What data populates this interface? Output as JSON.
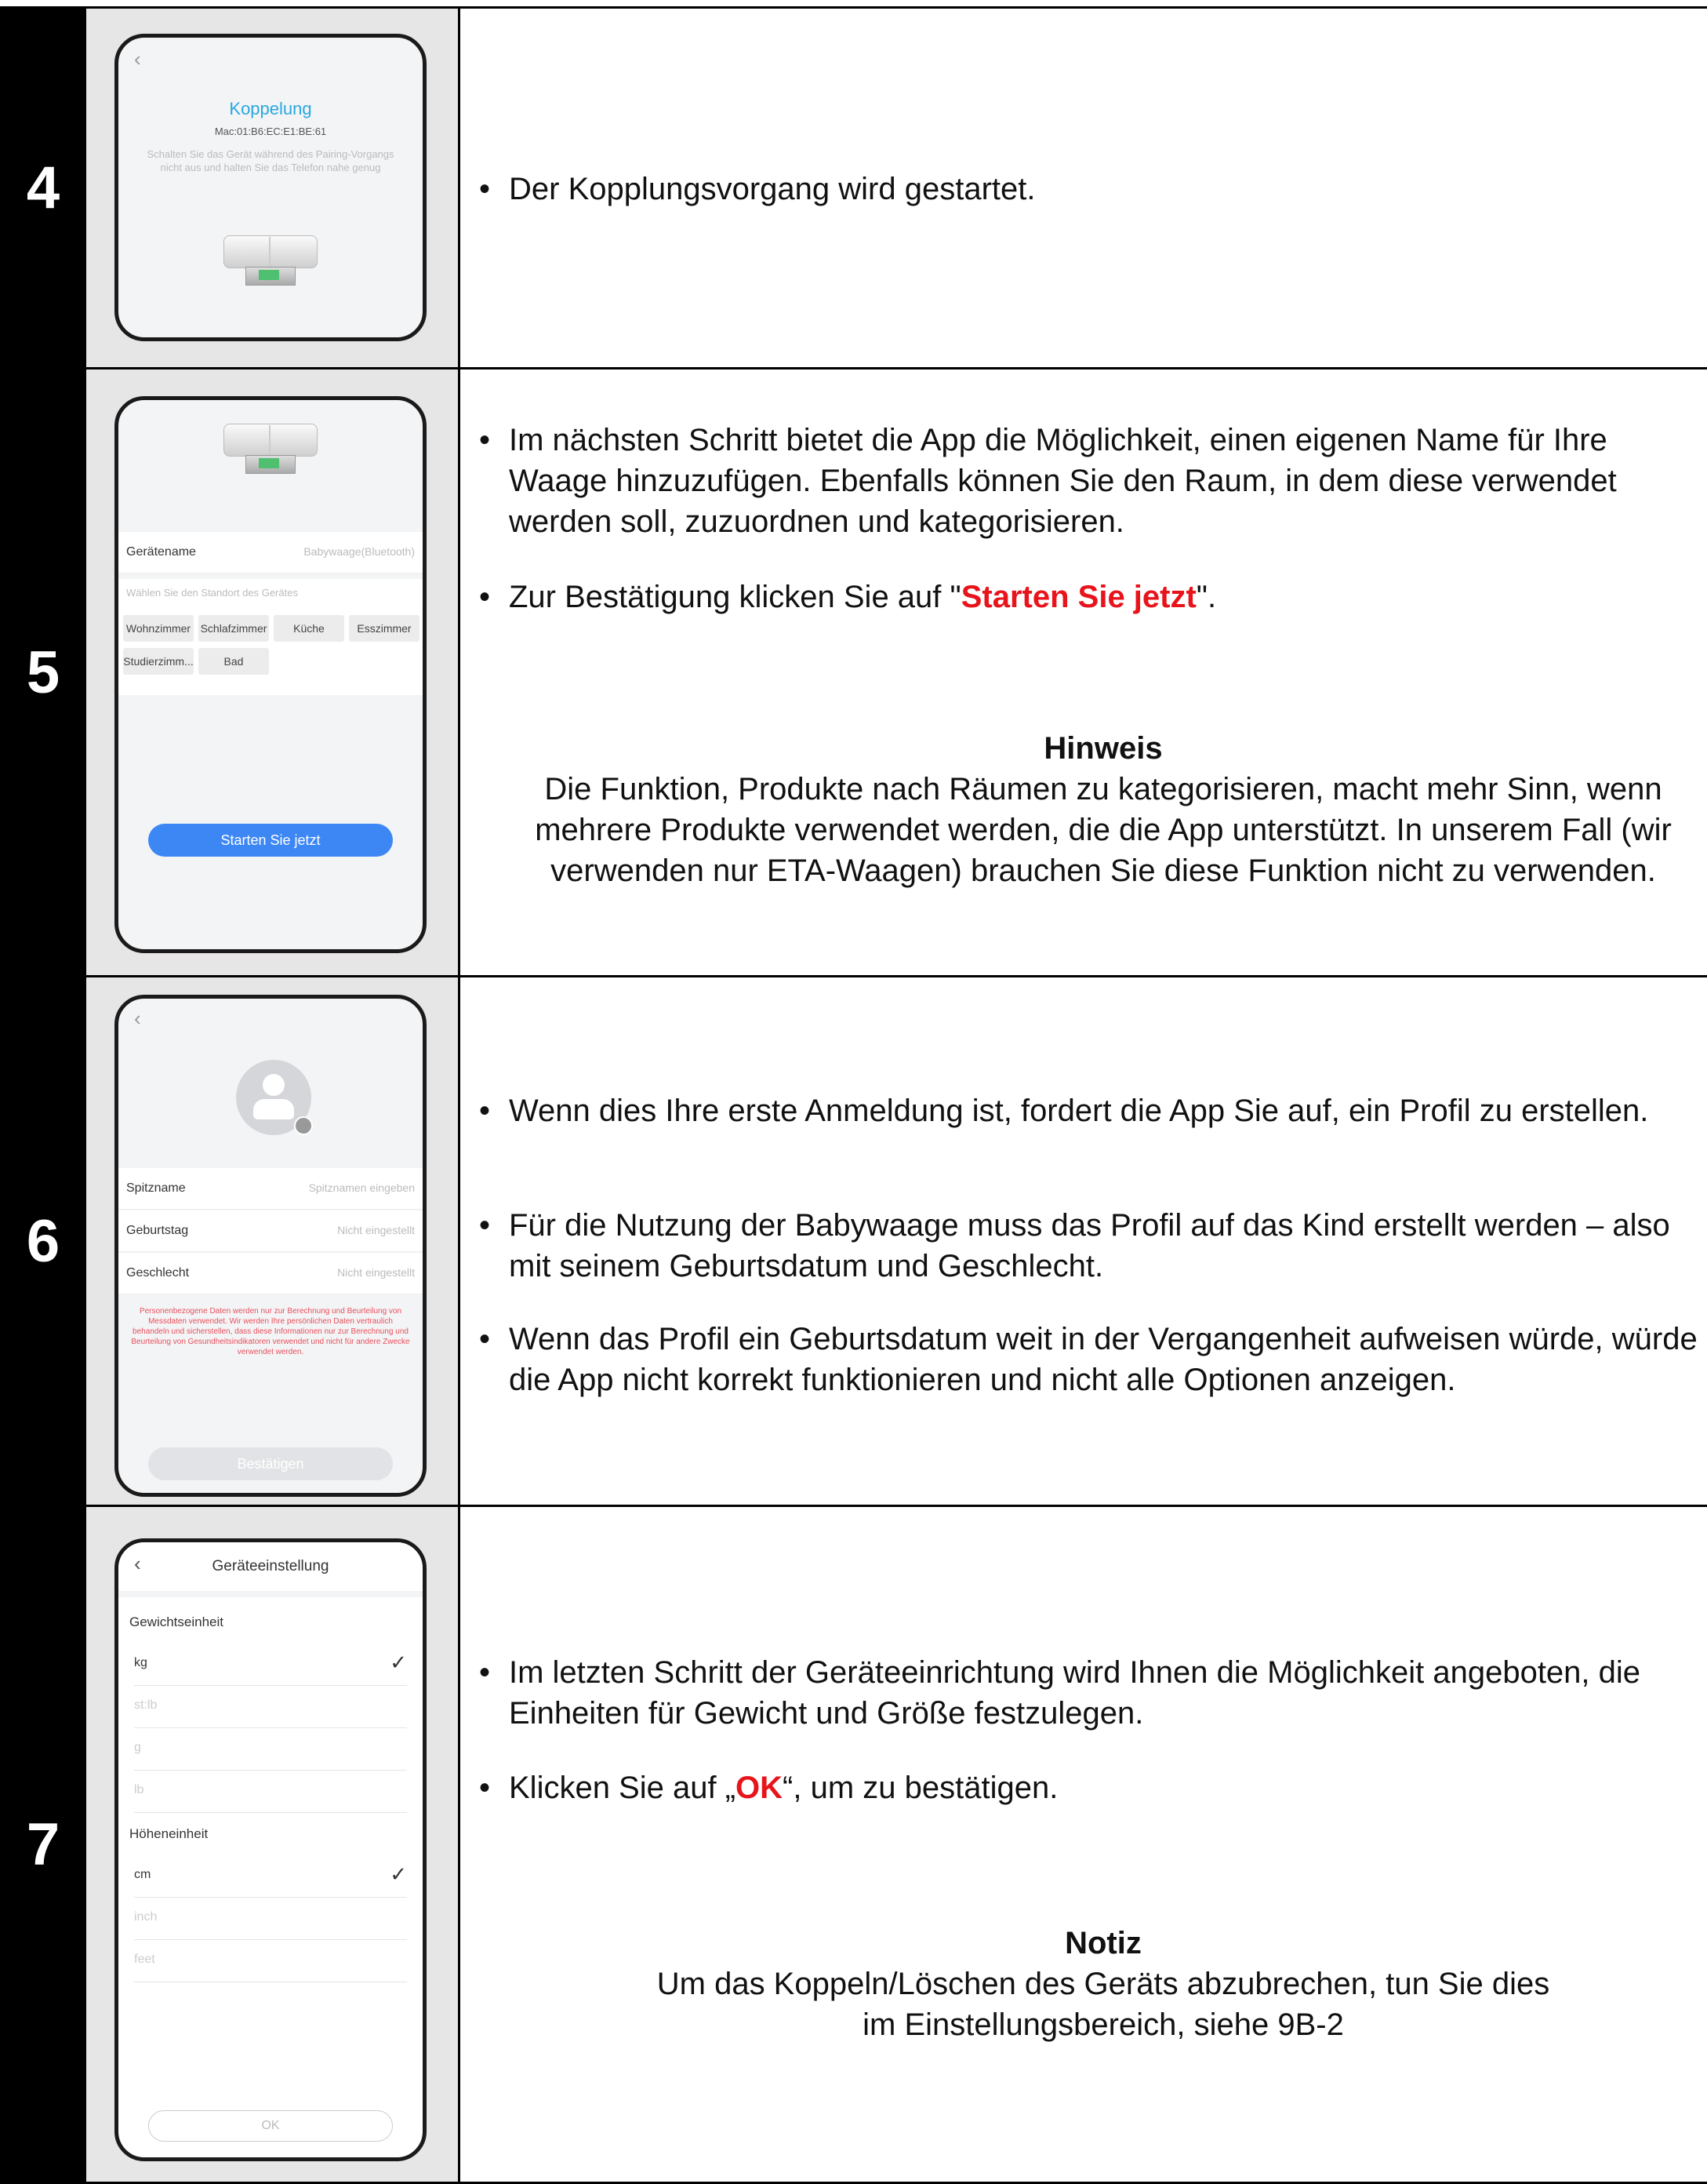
{
  "steps": [
    {
      "number": "4",
      "phone": {
        "back": "‹",
        "title": "Koppelung",
        "mac": "Mac:01:B6:EC:E1:BE:61",
        "hint": "Schalten Sie das Gerät während des Pairing-Vorgangs nicht aus und halten Sie das Telefon nahe genug"
      },
      "bullets": [
        "Der Kopplungsvorgang wird gestartet."
      ]
    },
    {
      "number": "5",
      "phone": {
        "device_label": "Gerätename",
        "device_value": "Babywaage(Bluetooth)",
        "location_prompt": "Wählen Sie den Standort des Gerätes",
        "rooms": [
          "Wohnzimmer",
          "Schlafzimmer",
          "Küche",
          "Esszimmer",
          "Studierzimm...",
          "Bad"
        ],
        "start_button": "Starten Sie jetzt"
      },
      "bullets": [
        "Im nächsten Schritt bietet die App die Möglichkeit, einen eigenen Name für Ihre Waage hinzuzufügen. Ebenfalls können Sie den Raum, in dem diese verwendet werden soll, zuzuordnen und kategorisieren."
      ],
      "confirm_prefix": "Zur Bestätigung klicken Sie auf  \"",
      "confirm_highlight": "Starten Sie jetzt",
      "confirm_suffix": "\".",
      "note_title": "Hinweis",
      "note_text": "Die Funktion, Produkte nach Räumen zu kategorisieren, macht mehr Sinn, wenn mehrere Produkte verwendet werden, die die App unterstützt. In unserem Fall (wir verwenden nur ETA-Waagen) brauchen Sie diese Funktion nicht zu verwenden."
    },
    {
      "number": "6",
      "phone": {
        "back": "‹",
        "rows": [
          {
            "label": "Spitzname",
            "value": "Spitznamen eingeben"
          },
          {
            "label": "Geburtstag",
            "value": "Nicht eingestellt"
          },
          {
            "label": "Geschlecht",
            "value": "Nicht eingestellt"
          }
        ],
        "privacy": "Personenbezogene Daten werden nur zur Berechnung und Beurteilung von Messdaten verwendet. Wir werden Ihre persönlichen Daten vertraulich behandeln und sicherstellen, dass diese Informationen nur zur Berechnung und Beurteilung von Gesundheitsindikatoren verwendet und nicht für andere Zwecke verwendet werden.",
        "confirm_button": "Bestätigen"
      },
      "bullets": [
        "Wenn dies Ihre erste Anmeldung ist, fordert die App Sie auf, ein Profil zu erstellen.",
        "Für die Nutzung der Babywaage muss das Profil auf  das Kind erstellt werden – also mit seinem Geburtsdatum und Geschlecht.",
        "Wenn das Profil ein Geburtsdatum weit in der Vergangenheit aufweisen würde, würde die App nicht korrekt funktionieren und nicht alle Optionen anzeigen."
      ]
    },
    {
      "number": "7",
      "phone": {
        "back": "‹",
        "title": "Geräteeinstellung",
        "weight_header": "Gewichtseinheit",
        "weight_units": [
          "kg",
          "st:lb",
          "g",
          "lb"
        ],
        "height_header": "Höheneinheit",
        "height_units": [
          "cm",
          "inch",
          "feet"
        ],
        "ok_button": "OK"
      },
      "bullets": [
        "Im letzten Schritt der Geräteeinrichtung wird Ihnen die Möglichkeit angeboten, die Einheiten für Gewicht und Größe festzulegen."
      ],
      "ok_prefix": "Klicken Sie auf  „",
      "ok_highlight": "OK",
      "ok_suffix": "“, um zu bestätigen.",
      "note_title": "Notiz",
      "note_line1": "Um das Koppeln/Löschen des Geräts abzubrechen, tun Sie dies",
      "note_line2": "im Einstellungsbereich, siehe 9B-2"
    }
  ],
  "colors": {
    "accent_blue": "#3d87f5",
    "title_blue": "#29a7e1",
    "red": "#e8141b"
  }
}
